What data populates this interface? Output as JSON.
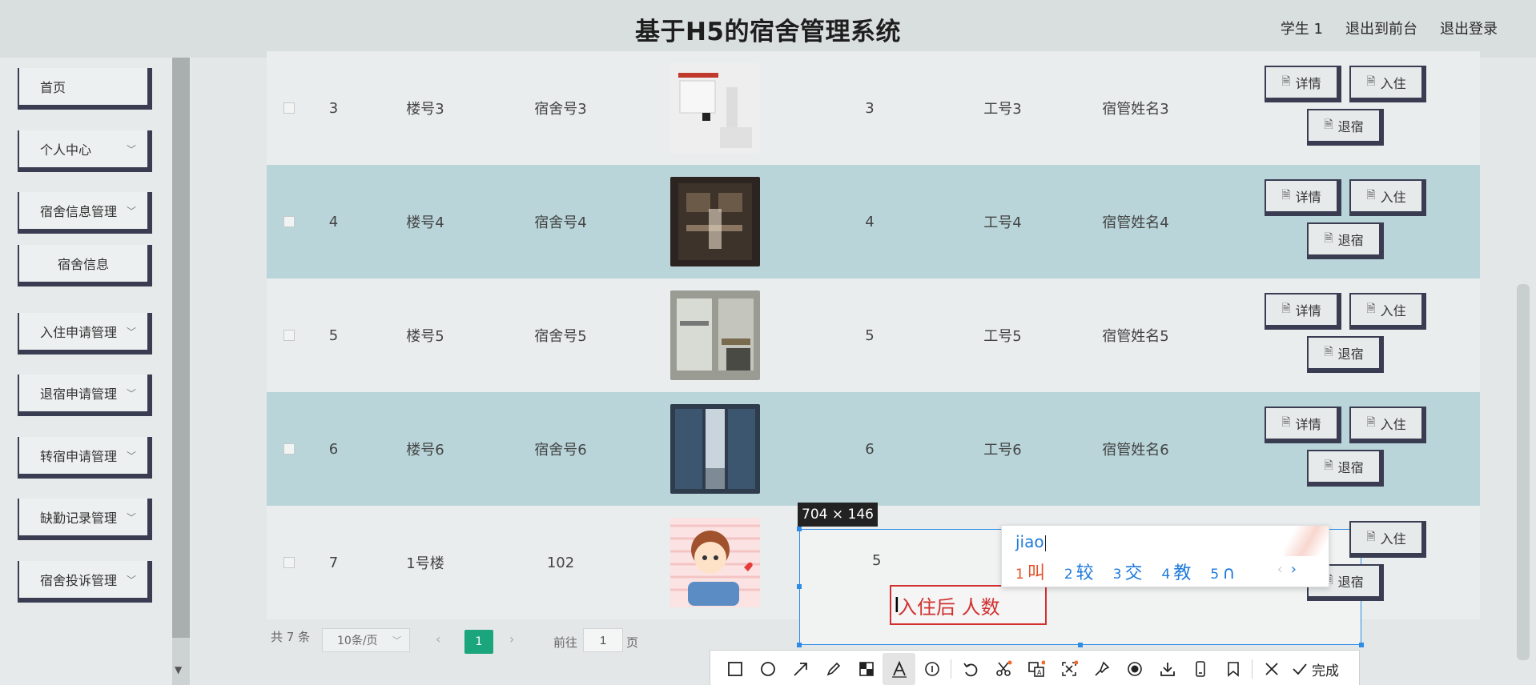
{
  "header": {
    "title": "基于H5的宿舍管理系统",
    "links": [
      "学生 1",
      "退出到前台",
      "退出登录"
    ]
  },
  "sidebar": {
    "items": [
      {
        "label": "首页",
        "has_arrow": false
      },
      {
        "label": "个人中心",
        "has_arrow": true
      },
      {
        "label": "宿舍信息管理",
        "has_arrow": true
      },
      {
        "label": "宿舍信息",
        "has_arrow": false
      },
      {
        "label": "入住申请管理",
        "has_arrow": true
      },
      {
        "label": "退宿申请管理",
        "has_arrow": true
      },
      {
        "label": "转宿申请管理",
        "has_arrow": true
      },
      {
        "label": "缺勤记录管理",
        "has_arrow": true
      },
      {
        "label": "宿舍投诉管理",
        "has_arrow": true
      }
    ]
  },
  "table": {
    "rows": [
      {
        "index": "3",
        "building": "楼号3",
        "dorm": "宿舍号3",
        "count": "3",
        "staff_id": "工号3",
        "manager": "宿管姓名3"
      },
      {
        "index": "4",
        "building": "楼号4",
        "dorm": "宿舍号4",
        "count": "4",
        "staff_id": "工号4",
        "manager": "宿管姓名4"
      },
      {
        "index": "5",
        "building": "楼号5",
        "dorm": "宿舍号5",
        "count": "5",
        "staff_id": "工号5",
        "manager": "宿管姓名5"
      },
      {
        "index": "6",
        "building": "楼号6",
        "dorm": "宿舍号6",
        "count": "6",
        "staff_id": "工号6",
        "manager": "宿管姓名6"
      },
      {
        "index": "7",
        "building": "1号楼",
        "dorm": "102",
        "count": "5",
        "staff_id": "",
        "manager": ""
      }
    ],
    "actions": {
      "detail": "详情",
      "checkin": "入住",
      "checkout": "退宿"
    }
  },
  "pagination": {
    "total": "共 7 条",
    "page_size": "10条/页",
    "current": "1",
    "goto_label": "前往",
    "goto_value": "1",
    "unit": "页"
  },
  "screenshot": {
    "size_label": "704 × 146",
    "annotation_text": "入住后 人数",
    "toolbar_done": "完成",
    "toolbar_tools": [
      "rectangle-icon",
      "ellipse-icon",
      "arrow-icon",
      "pen-icon",
      "mosaic-icon",
      "text-icon",
      "number-icon",
      "undo-icon",
      "cut-icon",
      "translate-icon",
      "ocr-icon",
      "pin-icon",
      "record-icon",
      "download-icon",
      "phone-icon",
      "bookmark-icon",
      "close-icon",
      "check-icon"
    ]
  },
  "ime": {
    "input": "jiao",
    "candidates": [
      {
        "num": "1",
        "text": "叫"
      },
      {
        "num": "2",
        "text": "较"
      },
      {
        "num": "3",
        "text": "交"
      },
      {
        "num": "4",
        "text": "教"
      },
      {
        "num": "5",
        "text": "∩"
      }
    ]
  },
  "colors": {
    "accent": "#1aa57c",
    "selection": "#2d8ce6",
    "annotation": "#d23030",
    "row_alt": "#b9d5da"
  }
}
